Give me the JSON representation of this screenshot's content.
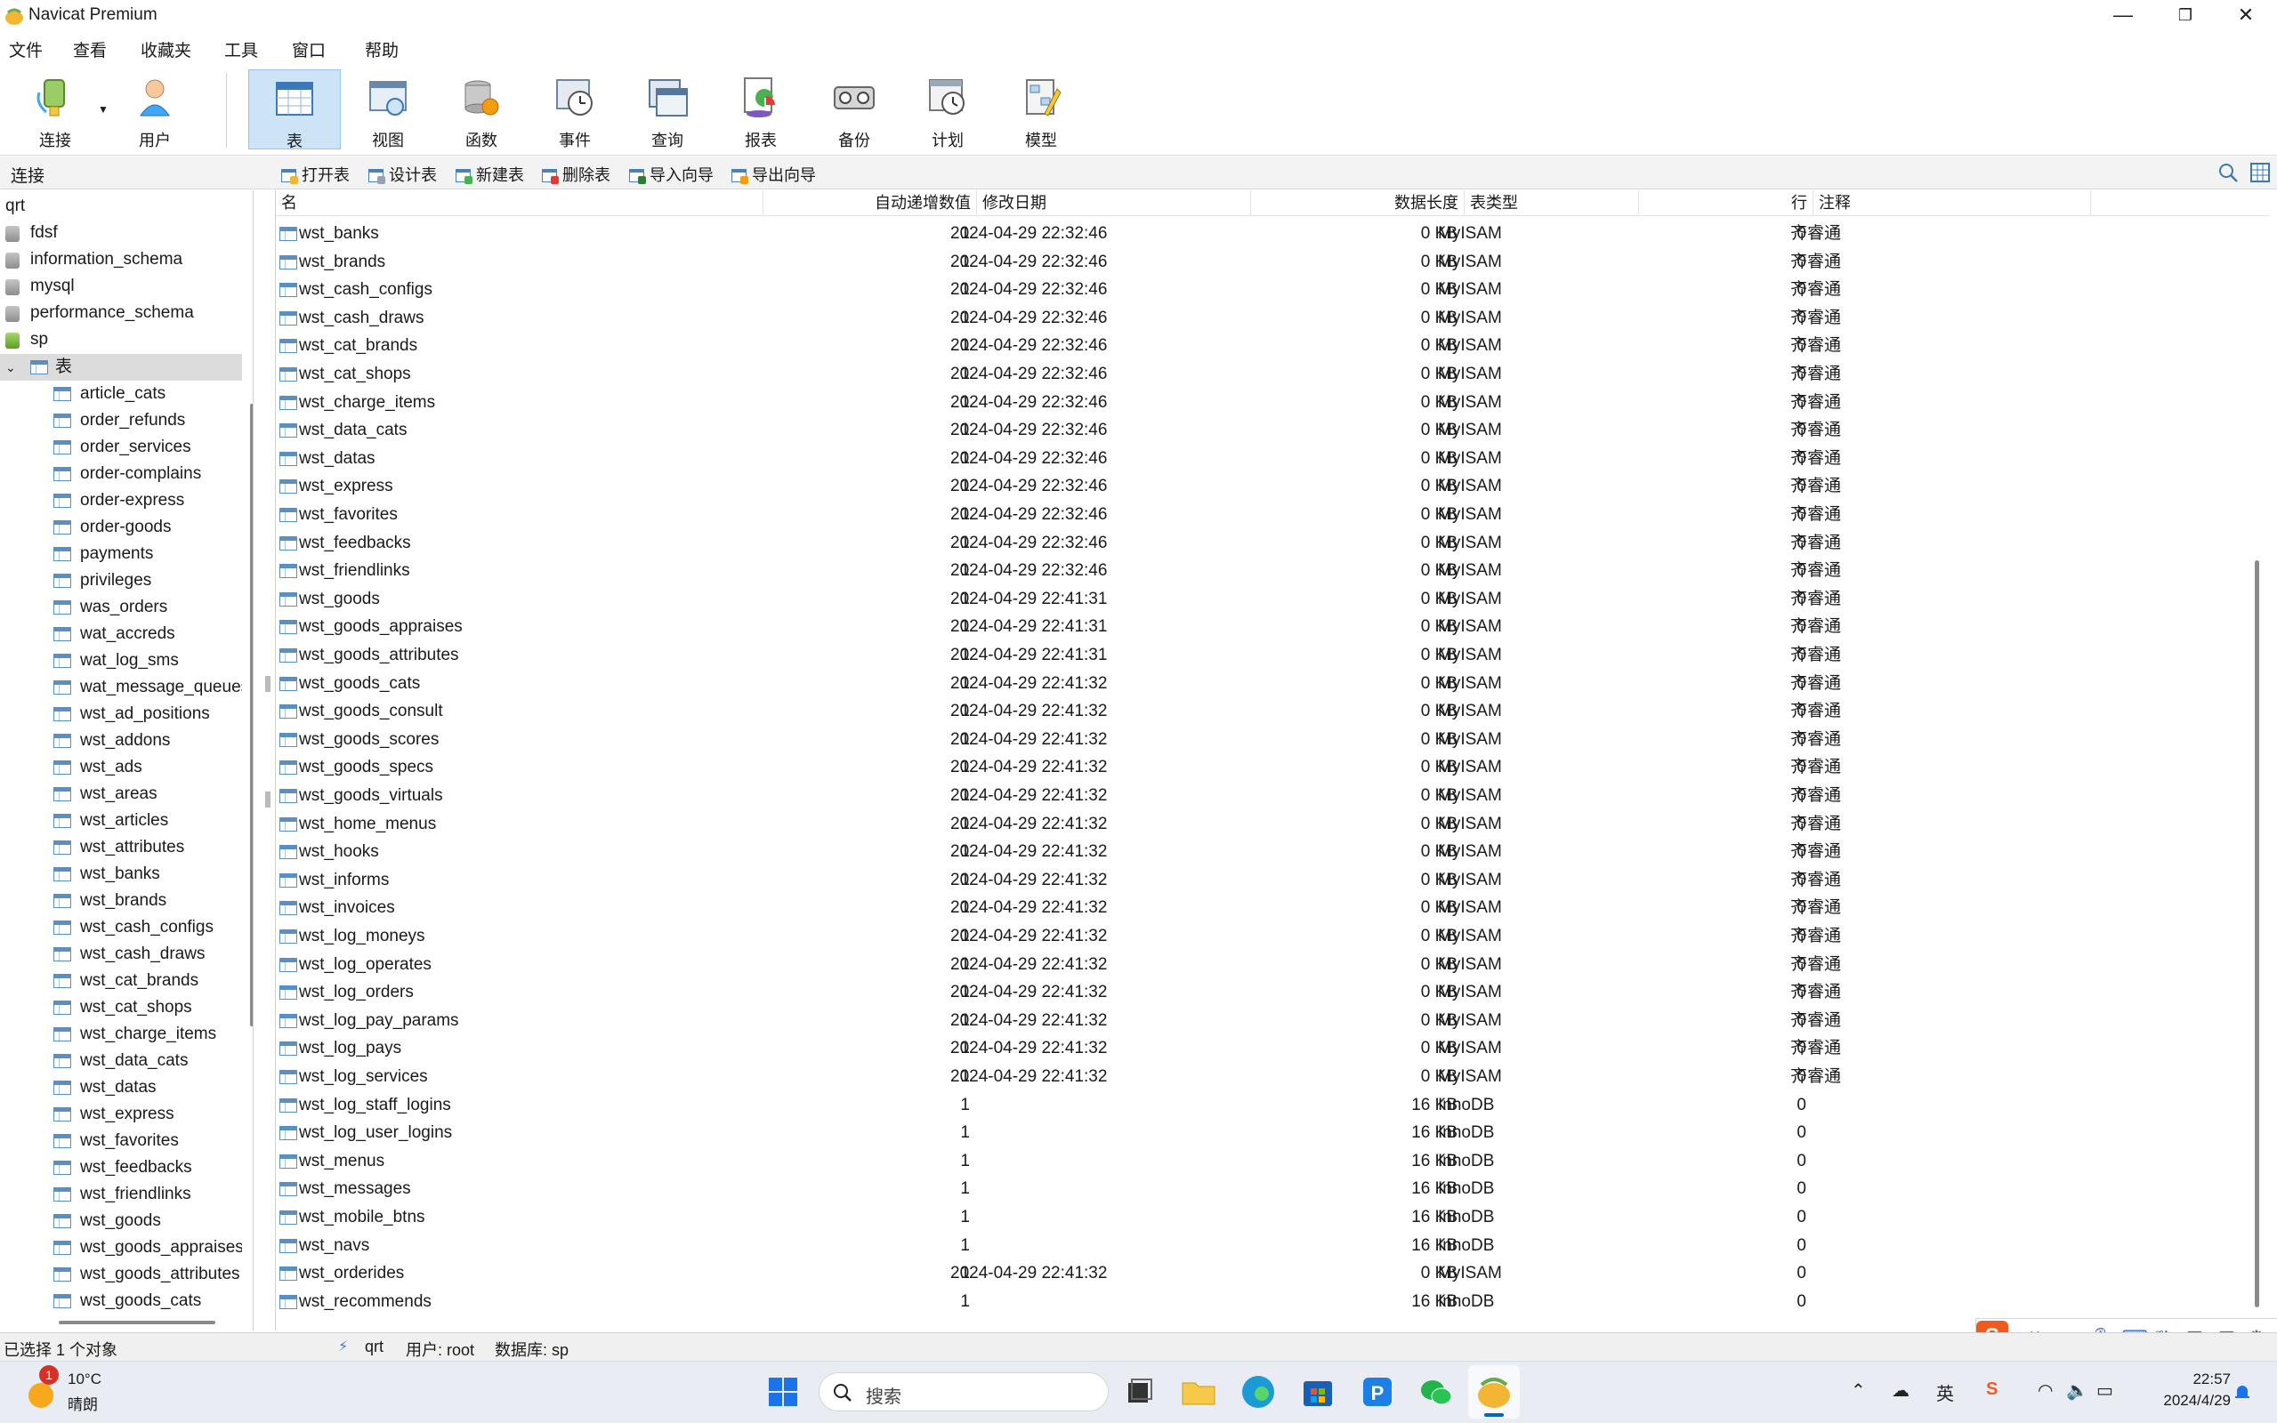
{
  "window": {
    "title": "Navicat Premium",
    "minimize_glyph": "—",
    "maximize_glyph": "❐",
    "close_glyph": "✕"
  },
  "menu": [
    "文件",
    "查看",
    "收藏夹",
    "工具",
    "窗口",
    "帮助"
  ],
  "toolbar": {
    "items": [
      {
        "label": "连接",
        "icon": "connection-icon"
      },
      {
        "label": "用户",
        "icon": "user-icon"
      },
      {
        "label": "表",
        "icon": "table-icon",
        "active": true
      },
      {
        "label": "视图",
        "icon": "view-icon"
      },
      {
        "label": "函数",
        "icon": "function-icon"
      },
      {
        "label": "事件",
        "icon": "event-icon"
      },
      {
        "label": "查询",
        "icon": "query-icon"
      },
      {
        "label": "报表",
        "icon": "report-icon"
      },
      {
        "label": "备份",
        "icon": "backup-icon"
      },
      {
        "label": "计划",
        "icon": "schedule-icon"
      },
      {
        "label": "模型",
        "icon": "model-icon"
      }
    ]
  },
  "subtoolbar": {
    "connection_label": "连接",
    "buttons": [
      "打开表",
      "设计表",
      "新建表",
      "删除表",
      "导入向导",
      "导出向导"
    ]
  },
  "tree": {
    "connection": "qrt",
    "databases": [
      "fdsf",
      "information_schema",
      "mysql",
      "performance_schema",
      "sp"
    ],
    "tables_node": "表",
    "tables": [
      "article_cats",
      "order_refunds",
      "order_services",
      "order-complains",
      "order-express",
      "order-goods",
      "payments",
      "privileges",
      "was_orders",
      "wat_accreds",
      "wat_log_sms",
      "wat_message_queues",
      "wst_ad_positions",
      "wst_addons",
      "wst_ads",
      "wst_areas",
      "wst_articles",
      "wst_attributes",
      "wst_banks",
      "wst_brands",
      "wst_cash_configs",
      "wst_cash_draws",
      "wst_cat_brands",
      "wst_cat_shops",
      "wst_charge_items",
      "wst_data_cats",
      "wst_datas",
      "wst_express",
      "wst_favorites",
      "wst_feedbacks",
      "wst_friendlinks",
      "wst_goods",
      "wst_goods_appraises",
      "wst_goods_attributes",
      "wst_goods_cats"
    ]
  },
  "grid": {
    "columns": [
      "名",
      "自动递增数值",
      "修改日期",
      "数据长度",
      "表类型",
      "行",
      "注释"
    ],
    "rows": [
      [
        "wst_banks",
        "1",
        "2024-04-29 22:32:46",
        "0 KB",
        "MyISAM",
        "0",
        "齐睿通"
      ],
      [
        "wst_brands",
        "1",
        "2024-04-29 22:32:46",
        "0 KB",
        "MyISAM",
        "0",
        "齐睿通"
      ],
      [
        "wst_cash_configs",
        "1",
        "2024-04-29 22:32:46",
        "0 KB",
        "MyISAM",
        "0",
        "齐睿通"
      ],
      [
        "wst_cash_draws",
        "1",
        "2024-04-29 22:32:46",
        "0 KB",
        "MyISAM",
        "0",
        "齐睿通"
      ],
      [
        "wst_cat_brands",
        "1",
        "2024-04-29 22:32:46",
        "0 KB",
        "MyISAM",
        "0",
        "齐睿通"
      ],
      [
        "wst_cat_shops",
        "1",
        "2024-04-29 22:32:46",
        "0 KB",
        "MyISAM",
        "0",
        "齐睿通"
      ],
      [
        "wst_charge_items",
        "1",
        "2024-04-29 22:32:46",
        "0 KB",
        "MyISAM",
        "0",
        "齐睿通"
      ],
      [
        "wst_data_cats",
        "1",
        "2024-04-29 22:32:46",
        "0 KB",
        "MyISAM",
        "0",
        "齐睿通"
      ],
      [
        "wst_datas",
        "1",
        "2024-04-29 22:32:46",
        "0 KB",
        "MyISAM",
        "0",
        "齐睿通"
      ],
      [
        "wst_express",
        "1",
        "2024-04-29 22:32:46",
        "0 KB",
        "MyISAM",
        "0",
        "齐睿通"
      ],
      [
        "wst_favorites",
        "1",
        "2024-04-29 22:32:46",
        "0 KB",
        "MyISAM",
        "0",
        "齐睿通"
      ],
      [
        "wst_feedbacks",
        "1",
        "2024-04-29 22:32:46",
        "0 KB",
        "MyISAM",
        "0",
        "齐睿通"
      ],
      [
        "wst_friendlinks",
        "1",
        "2024-04-29 22:32:46",
        "0 KB",
        "MyISAM",
        "0",
        "齐睿通"
      ],
      [
        "wst_goods",
        "1",
        "2024-04-29 22:41:31",
        "0 KB",
        "MyISAM",
        "0",
        "齐睿通"
      ],
      [
        "wst_goods_appraises",
        "1",
        "2024-04-29 22:41:31",
        "0 KB",
        "MyISAM",
        "0",
        "齐睿通"
      ],
      [
        "wst_goods_attributes",
        "1",
        "2024-04-29 22:41:31",
        "0 KB",
        "MyISAM",
        "0",
        "齐睿通"
      ],
      [
        "wst_goods_cats",
        "1",
        "2024-04-29 22:41:32",
        "0 KB",
        "MyISAM",
        "0",
        "齐睿通"
      ],
      [
        "wst_goods_consult",
        "1",
        "2024-04-29 22:41:32",
        "0 KB",
        "MyISAM",
        "0",
        "齐睿通"
      ],
      [
        "wst_goods_scores",
        "1",
        "2024-04-29 22:41:32",
        "0 KB",
        "MyISAM",
        "0",
        "齐睿通"
      ],
      [
        "wst_goods_specs",
        "1",
        "2024-04-29 22:41:32",
        "0 KB",
        "MyISAM",
        "0",
        "齐睿通"
      ],
      [
        "wst_goods_virtuals",
        "1",
        "2024-04-29 22:41:32",
        "0 KB",
        "MyISAM",
        "0",
        "齐睿通"
      ],
      [
        "wst_home_menus",
        "1",
        "2024-04-29 22:41:32",
        "0 KB",
        "MyISAM",
        "0",
        "齐睿通"
      ],
      [
        "wst_hooks",
        "1",
        "2024-04-29 22:41:32",
        "0 KB",
        "MyISAM",
        "0",
        "齐睿通"
      ],
      [
        "wst_informs",
        "1",
        "2024-04-29 22:41:32",
        "0 KB",
        "MyISAM",
        "0",
        "齐睿通"
      ],
      [
        "wst_invoices",
        "1",
        "2024-04-29 22:41:32",
        "0 KB",
        "MyISAM",
        "0",
        "齐睿通"
      ],
      [
        "wst_log_moneys",
        "1",
        "2024-04-29 22:41:32",
        "0 KB",
        "MyISAM",
        "0",
        "齐睿通"
      ],
      [
        "wst_log_operates",
        "1",
        "2024-04-29 22:41:32",
        "0 KB",
        "MyISAM",
        "0",
        "齐睿通"
      ],
      [
        "wst_log_orders",
        "1",
        "2024-04-29 22:41:32",
        "0 KB",
        "MyISAM",
        "0",
        "齐睿通"
      ],
      [
        "wst_log_pay_params",
        "1",
        "2024-04-29 22:41:32",
        "0 KB",
        "MyISAM",
        "0",
        "齐睿通"
      ],
      [
        "wst_log_pays",
        "1",
        "2024-04-29 22:41:32",
        "0 KB",
        "MyISAM",
        "0",
        "齐睿通"
      ],
      [
        "wst_log_services",
        "1",
        "2024-04-29 22:41:32",
        "0 KB",
        "MyISAM",
        "0",
        "齐睿通"
      ],
      [
        "wst_log_staff_logins",
        "1",
        "",
        "16 KB",
        "InnoDB",
        "0",
        ""
      ],
      [
        "wst_log_user_logins",
        "1",
        "",
        "16 KB",
        "InnoDB",
        "0",
        ""
      ],
      [
        "wst_menus",
        "1",
        "",
        "16 KB",
        "InnoDB",
        "0",
        ""
      ],
      [
        "wst_messages",
        "1",
        "",
        "16 KB",
        "InnoDB",
        "0",
        ""
      ],
      [
        "wst_mobile_btns",
        "1",
        "",
        "16 KB",
        "InnoDB",
        "0",
        ""
      ],
      [
        "wst_navs",
        "1",
        "",
        "16 KB",
        "InnoDB",
        "0",
        ""
      ],
      [
        "wst_orderides",
        "1",
        "2024-04-29 22:41:32",
        "0 KB",
        "MyISAM",
        "0",
        ""
      ],
      [
        "wst_recommends",
        "1",
        "",
        "16 KB",
        "InnoDB",
        "0",
        ""
      ]
    ]
  },
  "status": {
    "selection": "已选择 1 个对象",
    "connection": "qrt",
    "user": "用户: root",
    "database": "数据库: sp"
  },
  "taskbar": {
    "weather_temp": "10°C",
    "weather_desc": "晴朗",
    "weather_badge": "1",
    "search_placeholder": "搜索",
    "ime_lang": "英",
    "clock_time": "22:57",
    "clock_date": "2024/4/29"
  },
  "colors": {
    "accent": "#0067c0",
    "active_tool_bg": "#cde4f7",
    "ime_brand": "#ef5b1f"
  }
}
